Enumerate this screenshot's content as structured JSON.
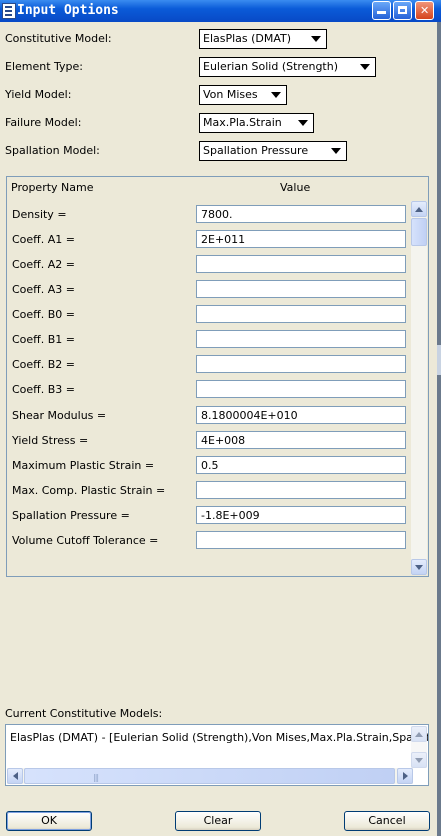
{
  "window": {
    "title": "Input Options"
  },
  "form": {
    "constitutive_model": {
      "label": "Constitutive Model:",
      "value": "ElasPlas (DMAT)"
    },
    "element_type": {
      "label": "Element Type:",
      "value": "Eulerian Solid (Strength)"
    },
    "yield_model": {
      "label": "Yield Model:",
      "value": "Von Mises"
    },
    "failure_model": {
      "label": "Failure Model:",
      "value": "Max.Pla.Strain"
    },
    "spallation_model": {
      "label": "Spallation Model:",
      "value": "Spallation Pressure"
    }
  },
  "properties": {
    "header_name": "Property Name",
    "header_value": "Value",
    "rows": [
      {
        "name": "Density =",
        "value": "7800."
      },
      {
        "name": "Coeff. A1 =",
        "value": "2E+011"
      },
      {
        "name": "Coeff. A2 =",
        "value": ""
      },
      {
        "name": "Coeff. A3 =",
        "value": ""
      },
      {
        "name": "Coeff. B0 =",
        "value": ""
      },
      {
        "name": "Coeff. B1 =",
        "value": ""
      },
      {
        "name": "Coeff. B2 =",
        "value": ""
      },
      {
        "name": "Coeff. B3 =",
        "value": ""
      },
      {
        "name": "Shear Modulus =",
        "value": "8.1800004E+010"
      },
      {
        "name": "Yield Stress =",
        "value": "4E+008"
      },
      {
        "name": "Maximum Plastic Strain =",
        "value": "0.5"
      },
      {
        "name": "Max. Comp. Plastic Strain =",
        "value": ""
      },
      {
        "name": "Spallation Pressure =",
        "value": "-1.8E+009"
      },
      {
        "name": "Volume Cutoff Tolerance =",
        "value": ""
      }
    ]
  },
  "current_models": {
    "label": "Current Constitutive Models:",
    "text": "ElasPlas (DMAT) - [Eulerian Solid (Strength),Von Mises,Max.Pla.Strain,Spallation Pre"
  },
  "buttons": {
    "ok": "OK",
    "clear": "Clear",
    "cancel": "Cancel"
  },
  "icons": {
    "app": "app-window-icon",
    "minimize": "minimize-icon",
    "maximize": "maximize-icon",
    "close": "close-icon",
    "dropdown": "chevron-down-icon",
    "scroll_up": "arrow-up-icon",
    "scroll_down": "arrow-down-icon",
    "scroll_left": "arrow-left-icon",
    "scroll_right": "arrow-right-icon"
  },
  "colors": {
    "titlebar": "#0a5bd8",
    "window_bg": "#ece9d8",
    "field_border": "#7f9db9"
  }
}
